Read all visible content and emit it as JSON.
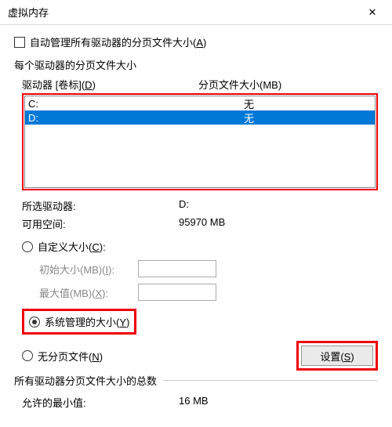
{
  "window": {
    "title": "虚拟内存"
  },
  "auto_manage": {
    "label": "自动管理所有驱动器的分页文件大小(",
    "accel": "A",
    "tail": ")"
  },
  "section": {
    "each_drive": "每个驱动器的分页文件大小"
  },
  "list": {
    "header": {
      "drive": "驱动器 [卷标](",
      "drive_accel": "D",
      "drive_tail": ")",
      "paging": "分页文件大小(MB)"
    },
    "rows": [
      {
        "drive": "C:",
        "paging": "无"
      },
      {
        "drive": "D:",
        "paging": "无"
      }
    ]
  },
  "selected": {
    "label": "所选驱动器:",
    "value": "D:"
  },
  "avail": {
    "label": "可用空间:",
    "value": "95970 MB"
  },
  "custom": {
    "label": "自定义大小(",
    "accel": "C",
    "tail": "):"
  },
  "initial": {
    "label": "初始大小(MB)(",
    "accel": "I",
    "tail": "):"
  },
  "max": {
    "label": "最大值(MB)(",
    "accel": "X",
    "tail": "):"
  },
  "system_managed": {
    "label": "系统管理的大小(",
    "accel": "Y",
    "tail": ")"
  },
  "no_paging": {
    "label": "无分页文件(",
    "accel": "N",
    "tail": ")"
  },
  "set_btn": {
    "label": "设置(",
    "accel": "S",
    "tail": ")"
  },
  "total": {
    "label": "所有驱动器分页文件大小的总数"
  },
  "min_allowed": {
    "label": "允许的最小值:",
    "value": "16 MB"
  }
}
